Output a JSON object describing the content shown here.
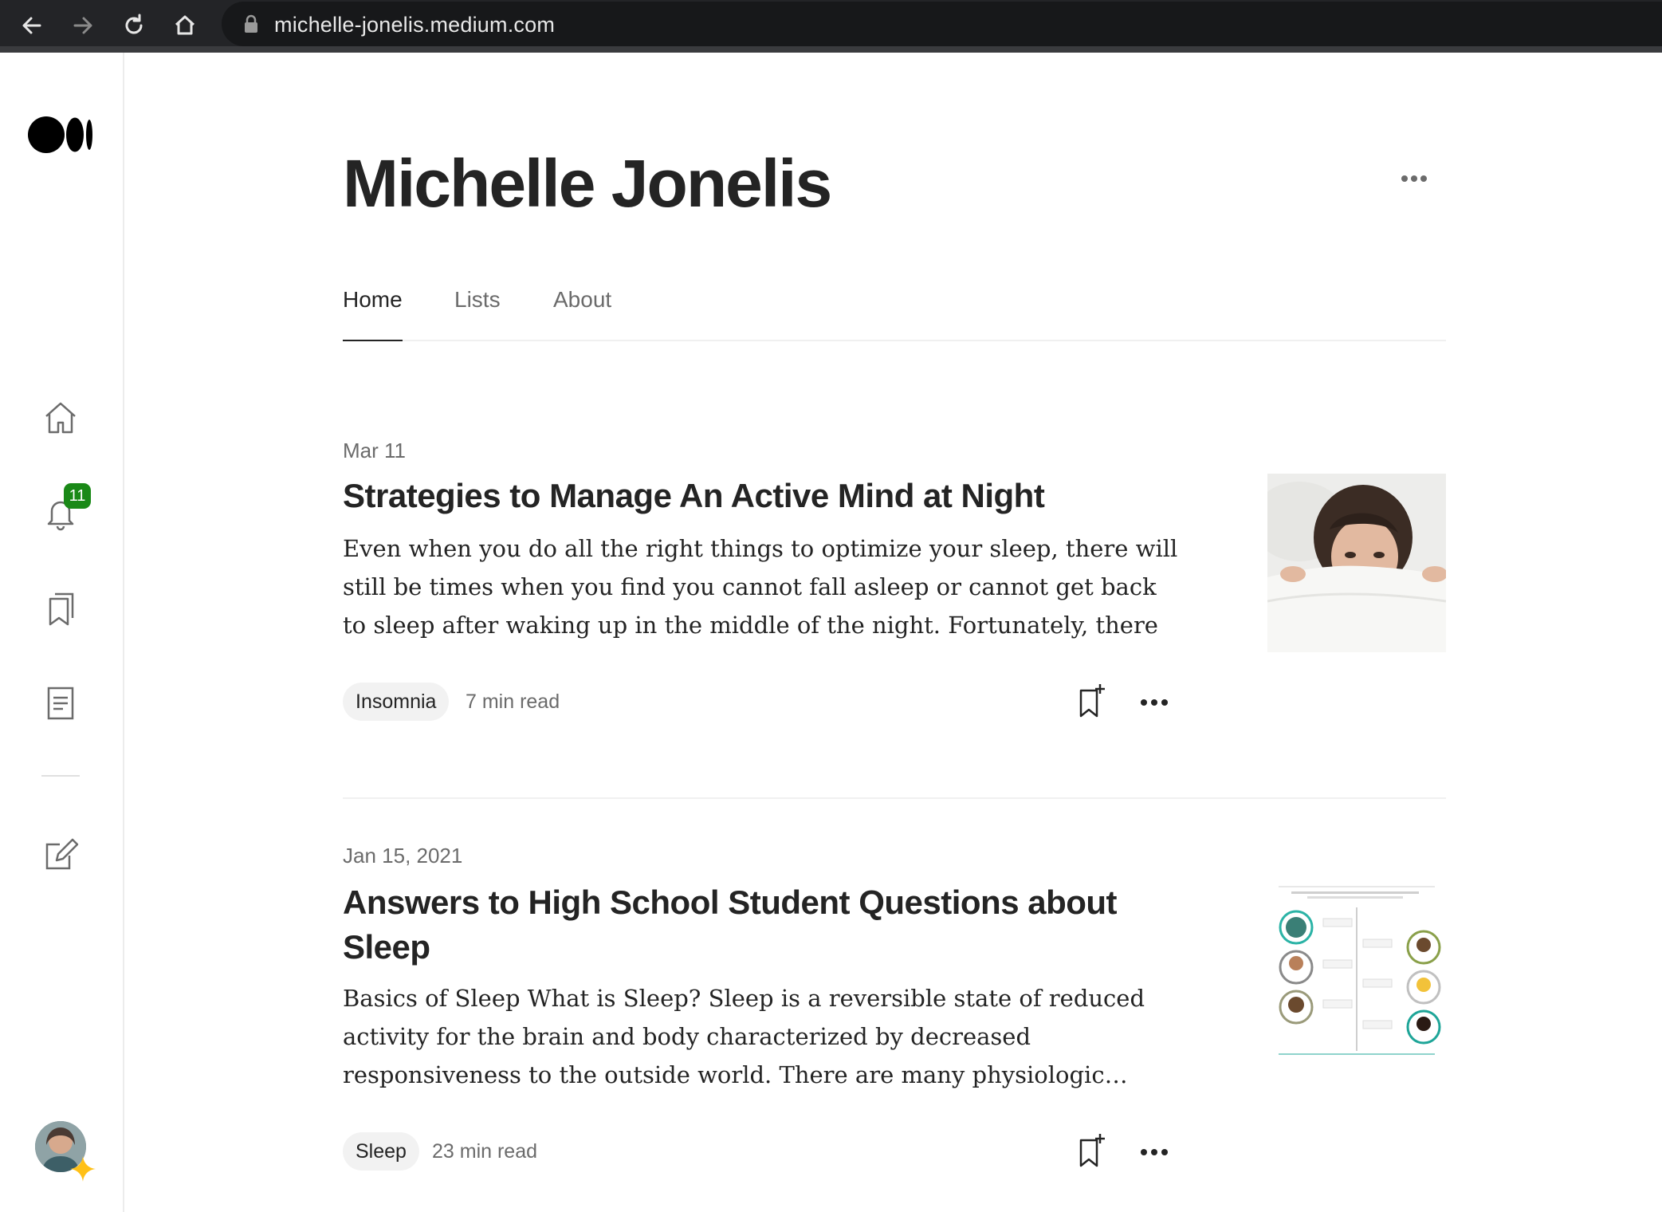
{
  "browser": {
    "url": "michelle-jonelis.medium.com"
  },
  "sidebar": {
    "notifications_count": "11"
  },
  "profile": {
    "name": "Michelle Jonelis"
  },
  "tabs": [
    {
      "label": "Home",
      "active": true
    },
    {
      "label": "Lists",
      "active": false
    },
    {
      "label": "About",
      "active": false
    }
  ],
  "articles": [
    {
      "date": "Mar 11",
      "title": "Strategies to Manage An Active Mind at Night",
      "excerpt": "Even when you do all the right things to optimize your sleep, there will still be times when you find you cannot fall asleep or cannot get back to sleep after waking up in the middle of the night. Fortunately, there are …",
      "tag": "Insomnia",
      "read_time": "7 min read"
    },
    {
      "date": "Jan 15, 2021",
      "title": "Answers to High School Student Questions about Sleep",
      "excerpt": "Basics of Sleep What is Sleep? Sleep is a reversible state of reduced activity for the brain and body characterized by decreased responsiveness to the outside world. There are many physiologic…",
      "tag": "Sleep",
      "read_time": "23 min read"
    }
  ],
  "colors": {
    "accent": "#1a8917",
    "text": "#242424",
    "muted": "#6b6b6b"
  }
}
